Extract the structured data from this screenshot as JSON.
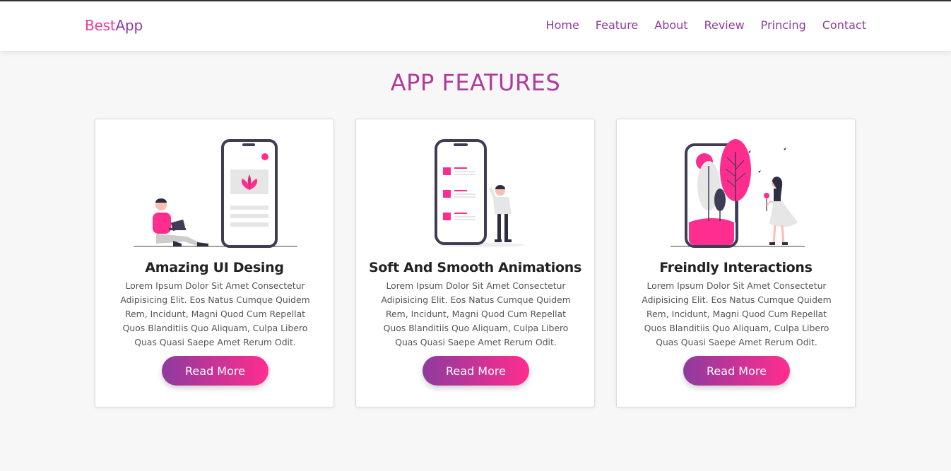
{
  "header": {
    "logo_part1": "Best",
    "logo_part2": "App",
    "nav": [
      "Home",
      "Feature",
      "About",
      "Review",
      "Princing",
      "Contact"
    ]
  },
  "section": {
    "title": "APP FEATURES"
  },
  "cards": [
    {
      "title": "Amazing UI Desing",
      "text": "Lorem Ipsum Dolor Sit Amet Consectetur Adipisicing Elit. Eos Natus Cumque Quidem Rem, Incidunt, Magni Quod Cum Repellat Quos Blanditiis Quo Aliquam, Culpa Libero Quas Quasi Saepe Amet Rerum Odit.",
      "button": "Read More",
      "illustration": "person-with-laptop-and-phone"
    },
    {
      "title": "Soft And Smooth Animations",
      "text": "Lorem Ipsum Dolor Sit Amet Consectetur Adipisicing Elit. Eos Natus Cumque Quidem Rem, Incidunt, Magni Quod Cum Repellat Quos Blanditiis Quo Aliquam, Culpa Libero Quas Quasi Saepe Amet Rerum Odit.",
      "button": "Read More",
      "illustration": "person-beside-phone-checklist"
    },
    {
      "title": "Freindly Interactions",
      "text": "Lorem Ipsum Dolor Sit Amet Consectetur Adipisicing Elit. Eos Natus Cumque Quidem Rem, Incidunt, Magni Quod Cum Repellat Quos Blanditiis Quo Aliquam, Culpa Libero Quas Quasi Saepe Amet Rerum Odit.",
      "button": "Read More",
      "illustration": "woman-with-flower-and-phone-trees"
    }
  ],
  "colors": {
    "brand_pink": "#e83e9a",
    "brand_purple": "#8e3b9e",
    "accent_pink": "#ff2d8e",
    "title": "#b03b9a"
  }
}
